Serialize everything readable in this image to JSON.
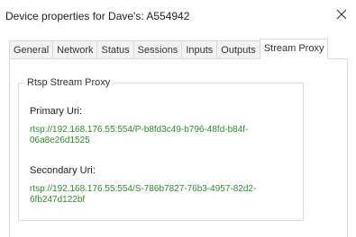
{
  "window": {
    "title": "Device properties for Dave's: A554942",
    "close_icon": "close-icon"
  },
  "tabs": [
    {
      "label": "General"
    },
    {
      "label": "Network"
    },
    {
      "label": "Status"
    },
    {
      "label": "Sessions"
    },
    {
      "label": "Inputs"
    },
    {
      "label": "Outputs"
    },
    {
      "label": "Stream Proxy",
      "active": true
    }
  ],
  "stream_proxy": {
    "group_title": "Rtsp Stream Proxy",
    "primary_label": "Primary Uri:",
    "primary_uri_line1": "rtsp://192.168.176.55:554/P-b8fd3c49-b796-48fd-b84f-",
    "primary_uri_line2": "06a8e26d1525",
    "secondary_label": "Secondary Uri:",
    "secondary_uri_line1": "rtsp://192.168.176.55:554/S-786b7827-76b3-4957-82d2-",
    "secondary_uri_line2": "6fb247d122bf"
  },
  "colors": {
    "uri_text": "#2f8a2f",
    "border": "#d9d9d9"
  }
}
